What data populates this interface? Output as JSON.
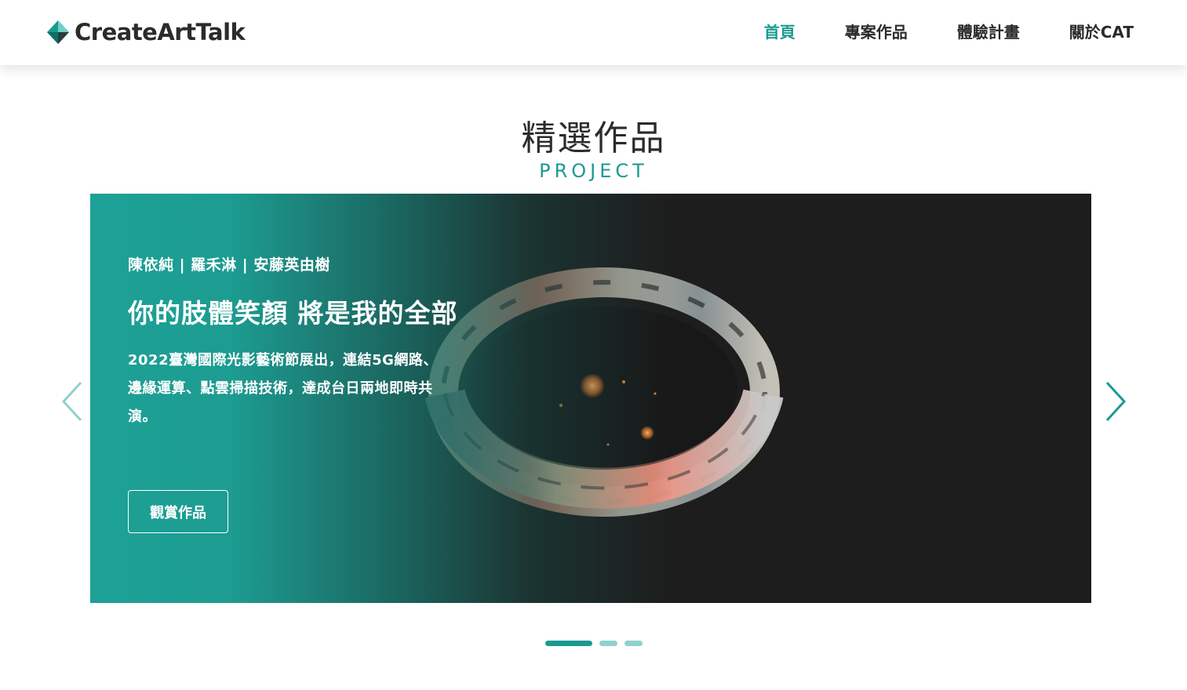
{
  "header": {
    "logo_text": "CreateArtTalk",
    "nav": [
      {
        "label": "首頁",
        "active": true
      },
      {
        "label": "專案作品",
        "active": false
      },
      {
        "label": "體驗計畫",
        "active": false
      },
      {
        "label": "關於CAT",
        "active": false
      }
    ]
  },
  "section": {
    "title": "精選作品",
    "subtitle": "PROJECT"
  },
  "carousel": {
    "slides": [
      {
        "authors": "陳依純 | 羅禾淋 | 安藤英由樹",
        "title": "你的肢體笑顏 將是我的全部",
        "description": "2022臺灣國際光影藝術節展出，連結5G網路、邊緣運算、點雲掃描技術，達成台日兩地即時共演。",
        "button_label": "觀賞作品"
      }
    ],
    "active_index": 0,
    "dot_count": 3
  },
  "colors": {
    "accent": "#1a9a91",
    "accent_light": "#8ed2cd",
    "text": "#2b2b2b",
    "slide_bg": "#1d1d1d"
  }
}
